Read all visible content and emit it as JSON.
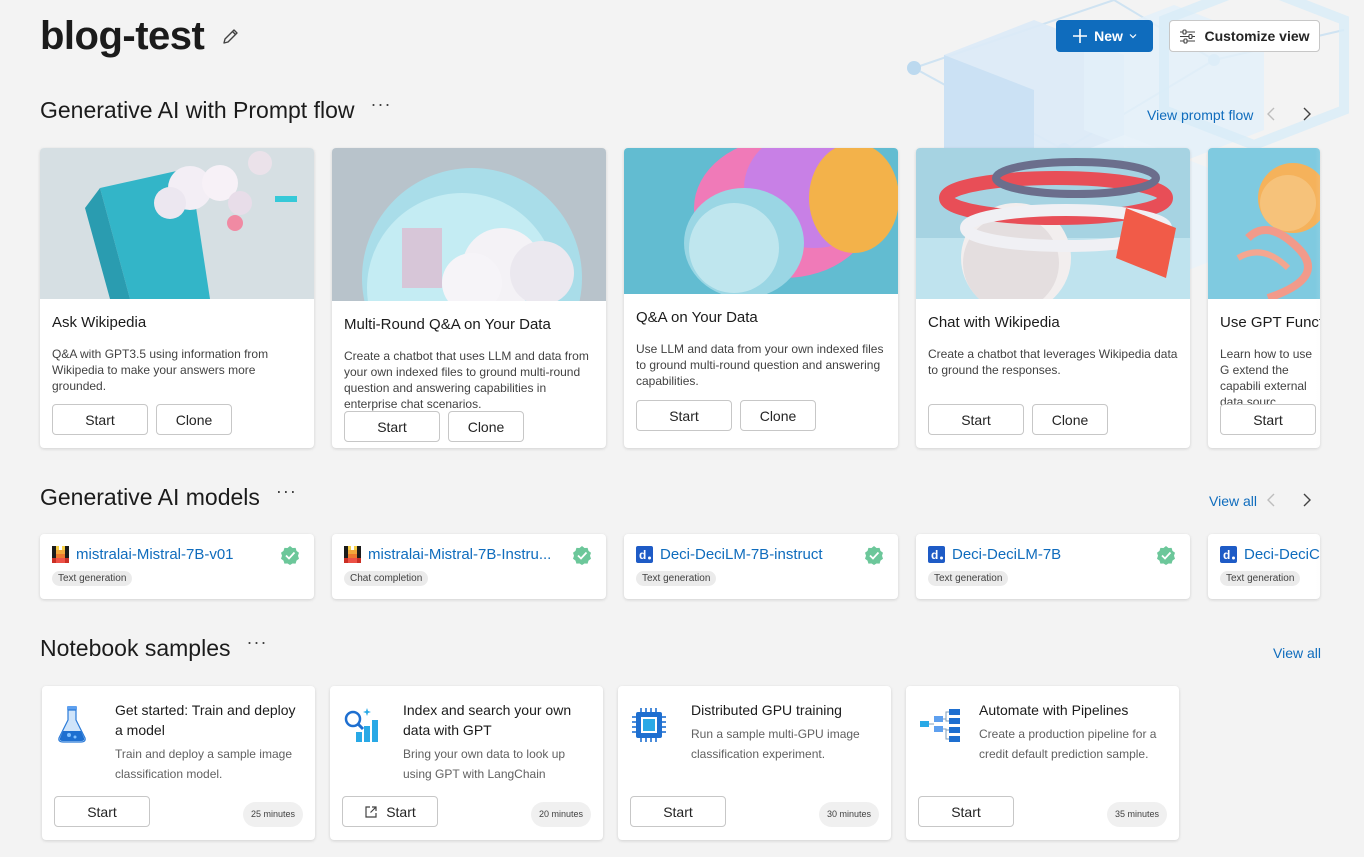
{
  "header": {
    "title": "blog-test",
    "new_label": "New",
    "customize_label": "Customize view"
  },
  "prompt_flow": {
    "title": "Generative AI with Prompt flow",
    "view_link": "View prompt flow",
    "cards": [
      {
        "title": "Ask Wikipedia",
        "desc": "Q&A with GPT3.5 using information from Wikipedia to make your answers more grounded.",
        "start": "Start",
        "clone": "Clone"
      },
      {
        "title": "Multi-Round Q&A on Your Data",
        "desc": "Create a chatbot that uses LLM and data from your own indexed files to ground multi-round question and answering capabilities in enterprise chat scenarios.",
        "start": "Start",
        "clone": "Clone"
      },
      {
        "title": "Q&A on Your Data",
        "desc": "Use LLM and data from your own indexed files to ground multi-round question and answering capabilities.",
        "start": "Start",
        "clone": "Clone"
      },
      {
        "title": "Chat with Wikipedia",
        "desc": "Create a chatbot that leverages Wikipedia data to ground the responses.",
        "start": "Start",
        "clone": "Clone"
      },
      {
        "title": "Use GPT Funct",
        "desc": "Learn how to use G extend the capabili external data sourc",
        "start": "Start"
      }
    ]
  },
  "models": {
    "title": "Generative AI models",
    "view_link": "View all",
    "cards": [
      {
        "name": "mistralai-Mistral-7B-v01",
        "tag": "Text generation",
        "logo": "mistral-logo-icon"
      },
      {
        "name": "mistralai-Mistral-7B-Instru...",
        "tag": "Chat completion",
        "logo": "mistral-logo-icon"
      },
      {
        "name": "Deci-DeciLM-7B-instruct",
        "tag": "Text generation",
        "logo": "deci-logo-icon"
      },
      {
        "name": "Deci-DeciLM-7B",
        "tag": "Text generation",
        "logo": "deci-logo-icon"
      },
      {
        "name": "Deci-DeciC",
        "tag": "Text generation",
        "logo": "deci-logo-icon"
      }
    ]
  },
  "notebooks": {
    "title": "Notebook samples",
    "view_link": "View all",
    "cards": [
      {
        "title": "Get started: Train and deploy a model",
        "desc": "Train and deploy a sample image classification model.",
        "start": "Start",
        "time": "25 minutes",
        "icon": "flask-icon"
      },
      {
        "title": "Index and search your own data with GPT",
        "desc": "Bring your own data to look up using GPT with LangChain",
        "start": "Start",
        "time": "20 minutes",
        "icon": "search-chart-icon"
      },
      {
        "title": "Distributed GPU training",
        "desc": "Run a sample multi-GPU image classification experiment.",
        "start": "Start",
        "time": "30 minutes",
        "icon": "chip-icon"
      },
      {
        "title": "Automate with Pipelines",
        "desc": "Create a production pipeline for a credit default prediction sample.",
        "start": "Start",
        "time": "35 minutes",
        "icon": "pipeline-icon"
      }
    ]
  },
  "colors": {
    "accent": "#0f6cbd",
    "success": "#6cc79a"
  }
}
